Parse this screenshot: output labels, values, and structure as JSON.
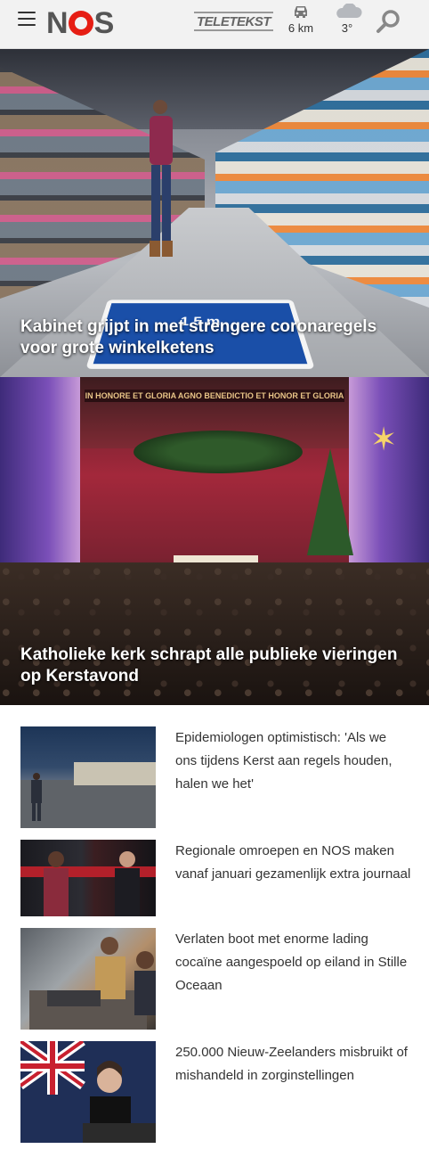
{
  "header": {
    "menu_label": "☰",
    "logo": "NOS",
    "teletekst": "TELETEKST",
    "traffic": {
      "value": "6 km",
      "icon": "car-icon"
    },
    "weather": {
      "value": "3°",
      "icon": "cloud-icon"
    },
    "search_icon": "search-icon"
  },
  "hero_stories": [
    {
      "headline": "Kabinet grijpt in met strengere coronaregels voor grote winkelketens",
      "sign_text": "1,5 m"
    },
    {
      "headline": "Katholieke kerk schrapt alle publieke vieringen op Kerstavond",
      "banner_text": "IN HONORE ET GLORIA AGNO BENEDICTIO ET HONOR ET GLORIA"
    }
  ],
  "articles": [
    {
      "title": "Epidemiologen optimistisch: 'Als we ons tijdens Kerst aan regels houden, halen we het'"
    },
    {
      "title": "Regionale omroepen en NOS maken vanaf januari gezamenlijk extra journaal"
    },
    {
      "title": "Verlaten boot met enorme lading cocaïne aangespoeld op eiland in Stille Oceaan"
    },
    {
      "title": "250.000 Nieuw-Zeelanders misbruikt of mishandeld in zorginstellingen"
    }
  ],
  "colors": {
    "brand_red": "#e61e14",
    "header_bg": "#f2f2f2"
  }
}
